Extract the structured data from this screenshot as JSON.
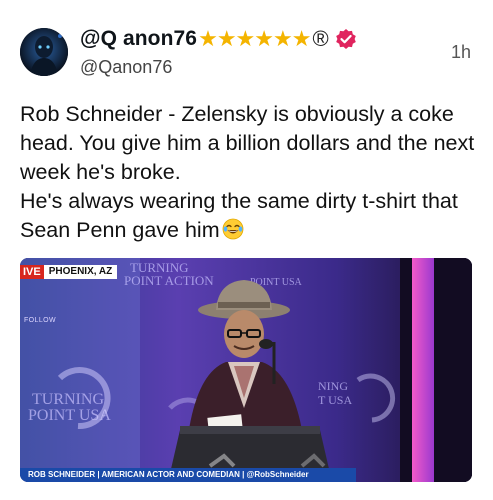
{
  "author": {
    "display_name": "@Q anon76",
    "handle": "@Qanon76",
    "stars": [
      "★",
      "★",
      "★",
      "★",
      "★",
      "★"
    ],
    "registered_mark": "®",
    "verified_color": "#e0245e"
  },
  "post": {
    "timestamp": "1h",
    "lines": [
      "Rob Schneider - Zelensky is obviously a coke head. You give him a billion dollars and the next week he's broke.",
      "He's always wearing the same dirty t-shirt that Sean Penn gave him"
    ],
    "emoji": "face-with-tears-of-joy"
  },
  "media": {
    "live_tag": "IVE",
    "location": "PHOENIX, AZ",
    "follow_label": "FOLLOW",
    "chyron": "ROB SCHNEIDER | AMERICAN ACTOR AND COMEDIAN | @RobSchneider",
    "backdrop_text": [
      "TURNING",
      "POINT ACTION",
      "POINT USA",
      "TURNING",
      "POINT USA",
      "NING",
      "T USA"
    ]
  },
  "colors": {
    "star": "#f4b400",
    "live": "#d7261e",
    "chyron": "#1a4aa8"
  }
}
